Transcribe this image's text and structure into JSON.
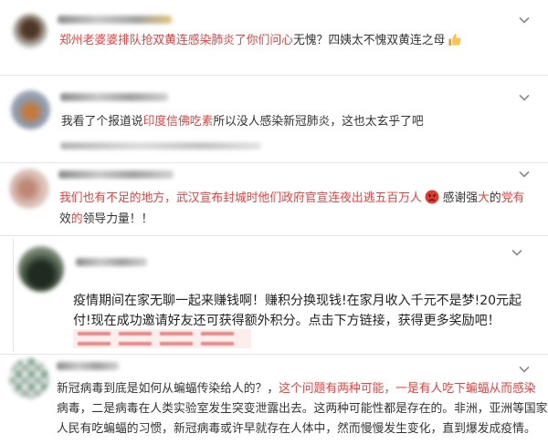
{
  "colors": {
    "highlight": "#e8403f",
    "text": "#333333",
    "divider": "#e6e6e6",
    "icon": "#8a8a8a"
  },
  "icons": {
    "comment_menu": "chevron-down-icon"
  },
  "comments": [
    {
      "lines": [
        {
          "segments": [
            {
              "text": "郑州老婆婆排队抢双黄连感染肺炎了你们问心",
              "highlight": true
            },
            {
              "text": "无愧？四姨太不愧双黄连之母",
              "highlight": false
            },
            {
              "icon": "thumbs-up-icon"
            }
          ]
        }
      ]
    },
    {
      "lines": [
        {
          "segments": [
            {
              "text": "我看了个报道说",
              "highlight": false
            },
            {
              "text": "印度信佛吃素",
              "highlight": true
            },
            {
              "text": "所以没人感染新冠肺炎，这也太玄乎了吧",
              "highlight": false
            }
          ]
        }
      ]
    },
    {
      "lines": [
        {
          "segments": [
            {
              "text": "我们也有不足的地方，武汉宣布封城时他们政府官宣连夜出逃五百万人",
              "highlight": true
            },
            {
              "icon": "angry-face-icon"
            },
            {
              "text": "感谢强",
              "highlight": false
            },
            {
              "text": "大",
              "highlight": true
            },
            {
              "text": "的",
              "highlight": false
            },
            {
              "text": "党有",
              "highlight": true
            }
          ]
        },
        {
          "segments": [
            {
              "text": "效",
              "highlight": false
            },
            {
              "text": "的",
              "highlight": true
            },
            {
              "text": "领导力量！！",
              "highlight": false
            }
          ]
        }
      ]
    },
    {
      "lines": [
        {
          "segments": [
            {
              "text": "疫情期间在家无聊一起来赚钱啊！赚积分换现钱!在家月收入千元不是梦!20元起",
              "highlight": false
            }
          ]
        },
        {
          "segments": [
            {
              "text": "付!现在成功邀请好友还可获得额外积分。点击下方链接，获得更多奖励吧！",
              "highlight": false
            }
          ]
        }
      ]
    },
    {
      "lines": [
        {
          "segments": [
            {
              "text": "新冠病毒到底是如何从蝙蝠传染给人的？，",
              "highlight": false
            },
            {
              "text": "这个问题有两种可能，一是有人吃下蝙蝠从而感染",
              "highlight": true
            }
          ]
        },
        {
          "segments": [
            {
              "text": "病毒，二是病毒在人类实验室发生突变泄露出去。这两种可能性都是存在的。非洲，亚洲等国家",
              "highlight": false
            }
          ]
        },
        {
          "segments": [
            {
              "text": "人民有吃蝙蝠的习惯，新冠病毒或许早就存在人体中，然而慢慢发生变化，直到爆发成疫情。",
              "highlight": false
            }
          ]
        }
      ]
    }
  ]
}
